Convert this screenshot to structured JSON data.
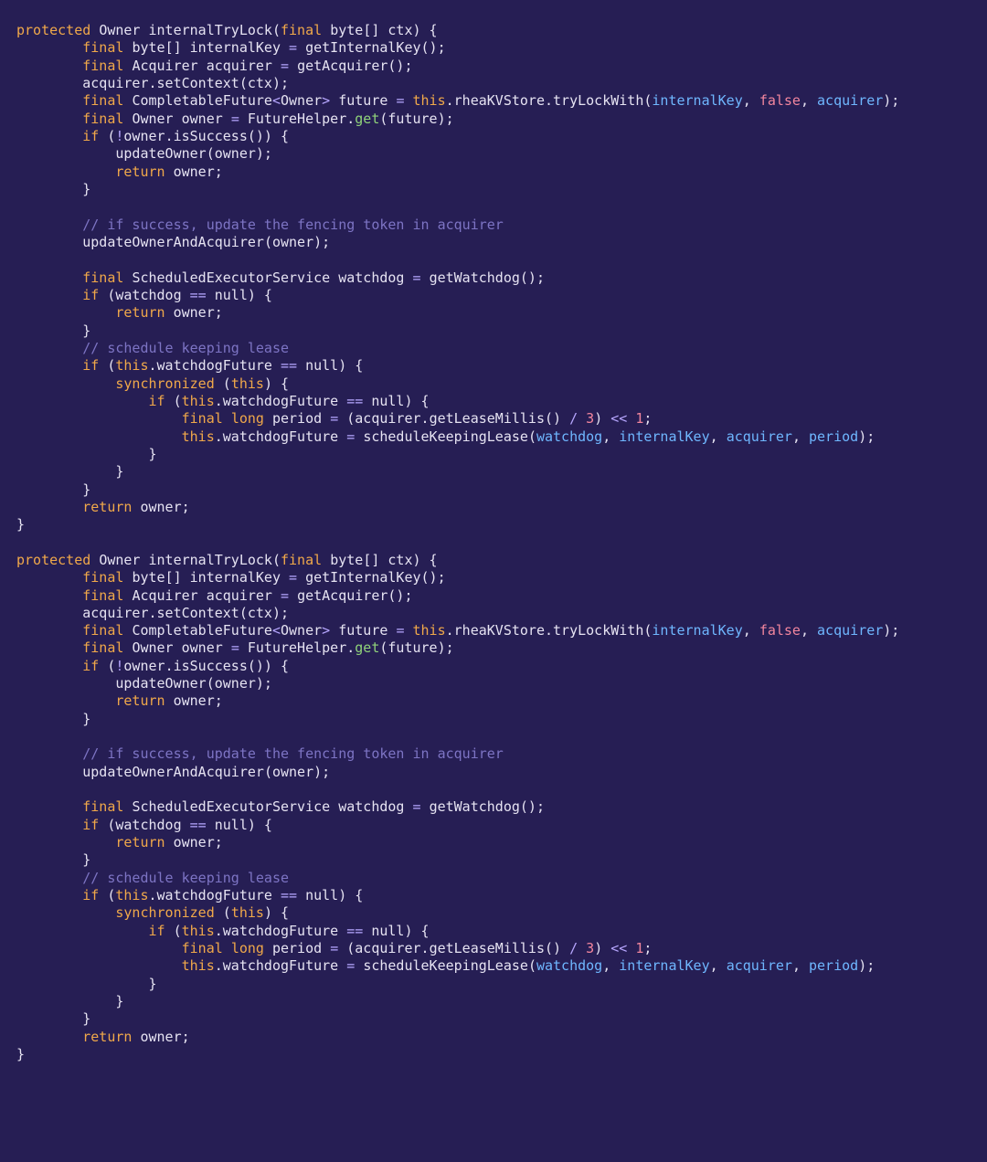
{
  "colors": {
    "background": "#261e54",
    "text": "#e6e3f2",
    "keyword": "#f0a84a",
    "operator": "#b7a7ff",
    "number": "#f2869e",
    "boolean": "#f2869e",
    "highlight_arg": "#6fb7ff",
    "comment": "#7d74c4",
    "green_fn": "#90d27a"
  },
  "code_block": {
    "language": "java",
    "repeated_times": 2,
    "tokens": {
      "kw_protected": "protected",
      "kw_final": "final",
      "kw_if": "if",
      "kw_return": "return",
      "kw_this": "this",
      "kw_synchronized": "synchronized",
      "kw_long": "long",
      "kw_byte": "byte",
      "kw_null": "null",
      "type_Owner": "Owner",
      "type_Acquirer": "Acquirer",
      "type_CompletableFuture": "CompletableFuture",
      "type_ScheduledExecutorService": "ScheduledExecutorService",
      "m_internalTryLock": "internalTryLock",
      "m_getInternalKey": "getInternalKey",
      "m_getAcquirer": "getAcquirer",
      "m_setContext": "setContext",
      "m_tryLockWith": "tryLockWith",
      "m_get": "get",
      "m_isSuccess": "isSuccess",
      "m_updateOwner": "updateOwner",
      "m_updateOwnerAndAcquirer": "updateOwnerAndAcquirer",
      "m_getWatchdog": "getWatchdog",
      "m_getLeaseMillis": "getLeaseMillis",
      "m_scheduleKeepingLease": "scheduleKeepingLease",
      "f_rheaKVStore": "rheaKVStore",
      "f_watchdogFuture": "watchdogFuture",
      "v_ctx": "ctx",
      "v_internalKey": "internalKey",
      "v_acquirer": "acquirer",
      "v_future": "future",
      "v_owner": "owner",
      "v_watchdog": "watchdog",
      "v_period": "period",
      "v_false": "false",
      "num_3": "3",
      "num_1": "1",
      "op_eq": "==",
      "op_not": "!",
      "op_div": "/",
      "op_shl": "<<",
      "op_assign": "=",
      "comment_success": "// if success, update the fencing token in acquirer",
      "comment_schedule": "// schedule keeping lease"
    }
  }
}
